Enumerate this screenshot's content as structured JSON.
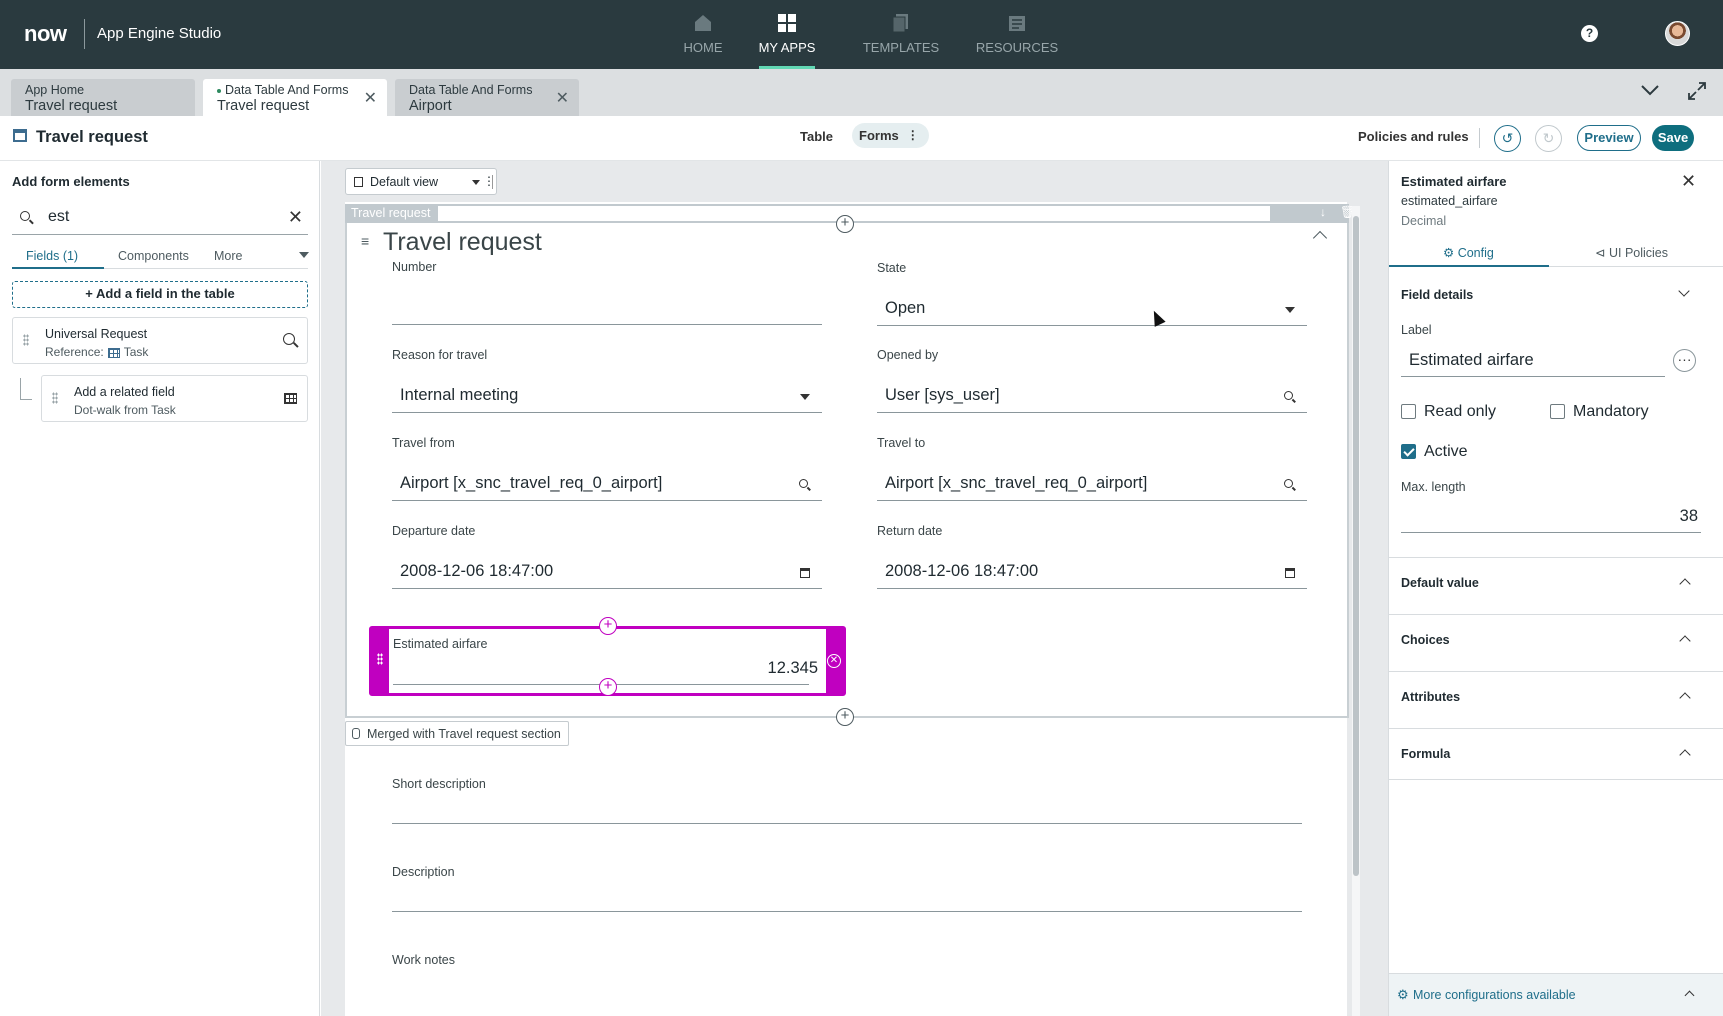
{
  "topbar": {
    "logo": "now",
    "studio_title": "App Engine Studio",
    "nav": [
      {
        "label": "HOME",
        "icon": "home-icon",
        "active": false
      },
      {
        "label": "MY APPS",
        "icon": "grid-icon",
        "active": true
      },
      {
        "label": "TEMPLATES",
        "icon": "templates-icon",
        "active": false
      },
      {
        "label": "RESOURCES",
        "icon": "resources-icon",
        "active": false
      }
    ],
    "help": "?"
  },
  "tabs": [
    {
      "line1": "App Home",
      "line2": "Travel request",
      "active": false,
      "closable": false
    },
    {
      "line1": "Data Table And Forms",
      "line2": "Travel request",
      "active": true,
      "closable": true
    },
    {
      "line1": "Data Table And Forms",
      "line2": "Airport",
      "active": false,
      "closable": true
    }
  ],
  "toolbar": {
    "title": "Travel request",
    "table_tab": "Table",
    "forms_tab": "Forms",
    "forms_more": "⋮",
    "policies": "Policies and rules",
    "preview": "Preview",
    "save": "Save"
  },
  "left_panel": {
    "title": "Add form elements",
    "search_value": "est",
    "tabs": [
      "Fields (1)",
      "Components",
      "More"
    ],
    "add_field": "+ Add a field in the table",
    "fields": [
      {
        "title": "Universal Request",
        "subtitle_prefix": "Reference:",
        "subtitle_ref": "Task"
      },
      {
        "title": "Add a related field",
        "subtitle": "Dot-walk from Task"
      }
    ]
  },
  "canvas": {
    "view": "Default view",
    "view_more": "⋮",
    "section_label": "Travel request",
    "section_title": "Travel request",
    "fields": [
      {
        "label": "Number",
        "value": "",
        "kind": "text"
      },
      {
        "label": "State",
        "value": "Open",
        "kind": "select"
      },
      {
        "label": "Reason for travel",
        "value": "Internal meeting",
        "kind": "select"
      },
      {
        "label": "Opened by",
        "value": "User [sys_user]",
        "kind": "reference"
      },
      {
        "label": "Travel from",
        "value": "Airport [x_snc_travel_req_0_airport]",
        "kind": "reference"
      },
      {
        "label": "Travel to",
        "value": "Airport [x_snc_travel_req_0_airport]",
        "kind": "reference"
      },
      {
        "label": "Departure date",
        "value": "2008-12-06 18:47:00",
        "kind": "date"
      },
      {
        "label": "Return date",
        "value": "2008-12-06 18:47:00",
        "kind": "date"
      }
    ],
    "selected_field": {
      "label": "Estimated airfare",
      "value": "12.345"
    },
    "merged_badge": "Merged with Travel request section",
    "wide_fields": [
      "Short description",
      "Description",
      "Work notes"
    ]
  },
  "right_panel": {
    "title": "Estimated airfare",
    "name": "estimated_airfare",
    "type": "Decimal",
    "tabs": [
      "Config",
      "UI Policies"
    ],
    "field_details": "Field details",
    "label_caption": "Label",
    "label_value": "Estimated airfare",
    "label_more": "···",
    "read_only": {
      "label": "Read only",
      "checked": false
    },
    "mandatory": {
      "label": "Mandatory",
      "checked": false
    },
    "active": {
      "label": "Active",
      "checked": true
    },
    "max_length_caption": "Max. length",
    "max_length": "38",
    "sections": [
      "Default value",
      "Choices",
      "Attributes",
      "Formula"
    ],
    "more_configs": "More configurations available"
  },
  "colors": {
    "nav_bg": "#2a3a3f",
    "accent": "#1f6e8a",
    "save_bg": "#0e6e7e",
    "selection": "#c000c0",
    "nav_active_underline": "#62d8b4"
  }
}
